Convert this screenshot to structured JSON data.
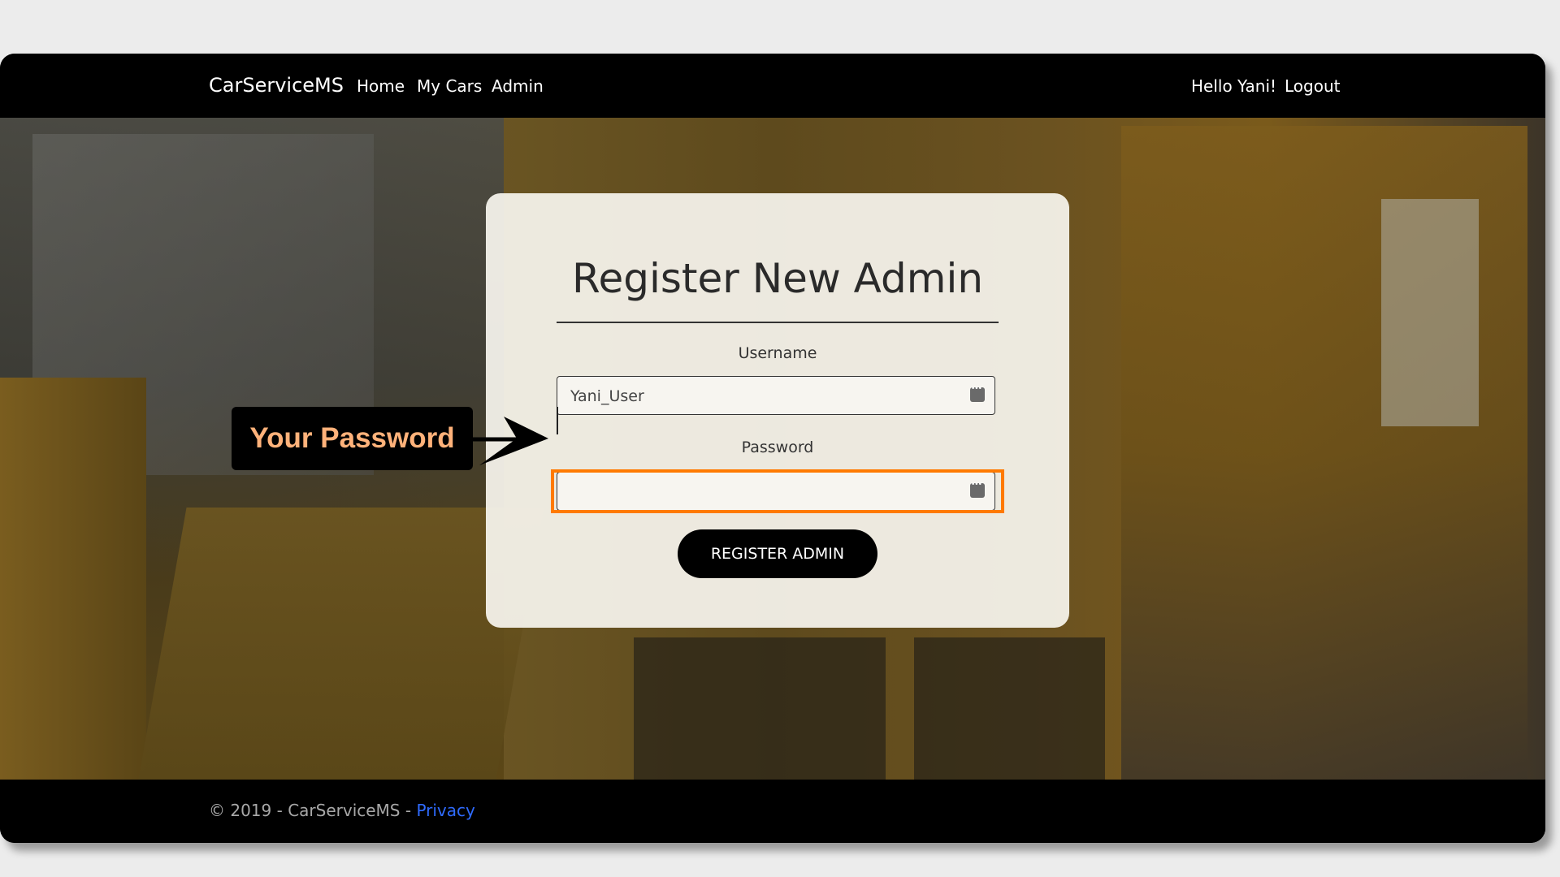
{
  "navbar": {
    "brand": "CarServiceMS",
    "links": [
      "Home",
      "My Cars",
      "Admin"
    ],
    "greeting": "Hello Yani!",
    "logout": "Logout"
  },
  "form": {
    "title": "Register New Admin",
    "username_label": "Username",
    "username_value": "Yani_User",
    "password_label": "Password",
    "password_value": "",
    "submit_label": "REGISTER ADMIN"
  },
  "callout": {
    "text": "Your Password"
  },
  "footer": {
    "copyright": "© 2019 - CarServiceMS - ",
    "privacy": "Privacy"
  },
  "colors": {
    "highlight": "#ff7a00",
    "callout_text": "#ffb27a",
    "link": "#2f6bff"
  },
  "icons": {
    "field_autofill": "password-manager-icon",
    "pointer": "arrow-pointer-icon"
  }
}
